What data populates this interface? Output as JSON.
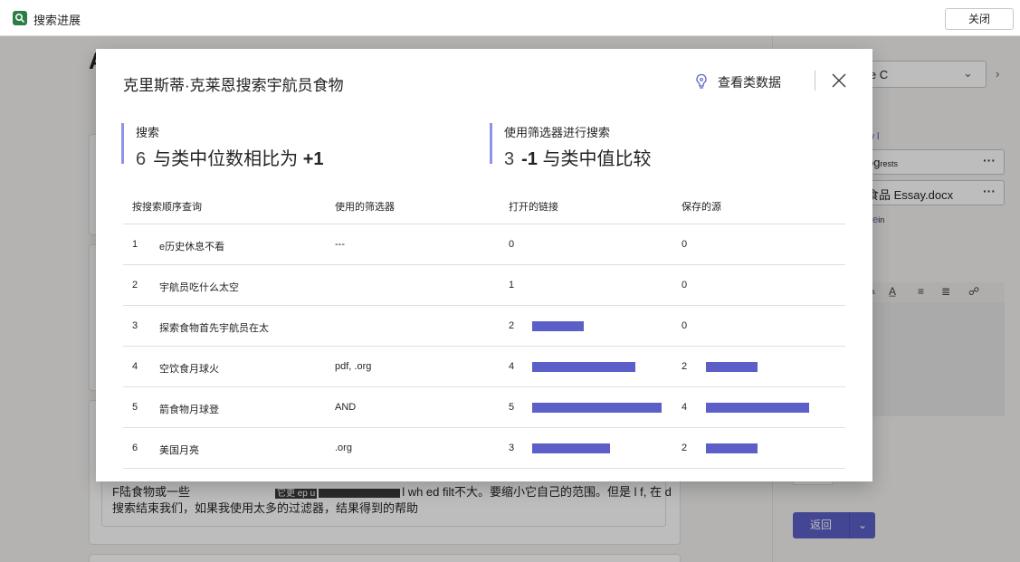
{
  "app": {
    "title": "搜索进展",
    "close_label": "关闭"
  },
  "background": {
    "heading_fragment": "A",
    "essay_line1_start": "F陆食物或一些",
    "essay_line1_mid": "它更 ep u",
    "essay_line1_end": "l wh     ed filt不大。要缩小它自己的范围。但是  l f, 在  d",
    "essay_line2": "搜索结束我们，如果我使用太多的过滤器，结果得到的帮助",
    "side_select_text": "ie C",
    "side_link1": "w l",
    "side_file1": "og",
    "side_file1_small": "rests",
    "side_file2": "食品 Essay.docx",
    "side_link2": "de",
    "side_link2_small": "in",
    "editor_text": "k",
    "back_label": "返回"
  },
  "modal": {
    "title": "克里斯蒂·克莱恩搜索宇航员食物",
    "view_data_label": "查看类数据",
    "stats": [
      {
        "label": "搜索",
        "count": "6",
        "text": "与类中位数相比为",
        "delta": "+1"
      },
      {
        "label": "使用筛选器进行搜索",
        "count": "3",
        "delta": "-1",
        "text": "与类中值比较"
      }
    ],
    "table": {
      "headers": [
        "按搜索顺序查询",
        "使用的筛选器",
        "打开的链接",
        "保存的源"
      ],
      "max_value": 5,
      "rows": [
        {
          "n": "1",
          "query": "e历史休息不看",
          "filters": "---",
          "links": 0,
          "links_label": "0",
          "saved": 0,
          "saved_label": "0"
        },
        {
          "n": "2",
          "query": "宇航员吃什么太空",
          "filters": "",
          "links": 1,
          "links_label": "1",
          "saved": 0,
          "saved_label": "0"
        },
        {
          "n": "3",
          "query": "探索食物首先宇航员在太",
          "filters": "",
          "links": 2,
          "links_label": "2",
          "saved": 0,
          "saved_label": "0"
        },
        {
          "n": "4",
          "query": "空饮食月球火",
          "filters": "pdf, .org",
          "links": 4,
          "links_label": "4",
          "saved": 2,
          "saved_label": "2"
        },
        {
          "n": "5",
          "query": "箭食物月球登",
          "filters": "AND",
          "links": 5,
          "links_label": "5",
          "saved": 4,
          "saved_label": "4"
        },
        {
          "n": "6",
          "query": "美国月亮",
          "filters": ".org",
          "links": 3,
          "links_label": "3",
          "saved": 2,
          "saved_label": "2"
        }
      ]
    }
  },
  "colors": {
    "accent": "#5b5fc7",
    "stat_border": "#8f93e6",
    "app_icon": "#2d7d46"
  }
}
